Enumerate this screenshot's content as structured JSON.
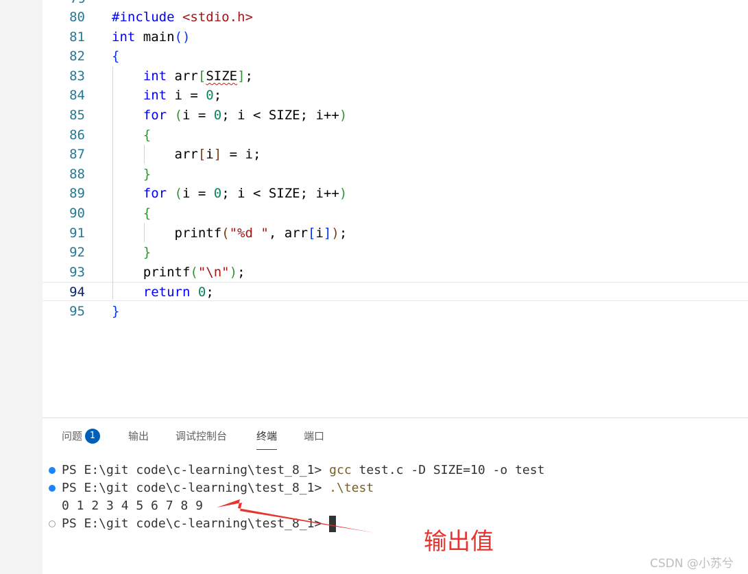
{
  "editor": {
    "top_partial_line_number": "79",
    "lines": [
      {
        "num": "80",
        "segments": [
          {
            "t": "#include ",
            "c": "pp"
          },
          {
            "t": "<stdio.h>",
            "c": "inc"
          }
        ]
      },
      {
        "num": "81",
        "segments": [
          {
            "t": "int",
            "c": "kw"
          },
          {
            "t": " main",
            "c": ""
          },
          {
            "t": "()",
            "c": "br1"
          }
        ]
      },
      {
        "num": "82",
        "segments": [
          {
            "t": "{",
            "c": "br1"
          }
        ]
      },
      {
        "num": "83",
        "segments": [
          {
            "t": "    ",
            "c": ""
          },
          {
            "t": "int",
            "c": "kw"
          },
          {
            "t": " arr",
            "c": ""
          },
          {
            "t": "[",
            "c": "br2"
          },
          {
            "t": "SIZE",
            "c": "squiggle"
          },
          {
            "t": "]",
            "c": "br2"
          },
          {
            "t": ";",
            "c": ""
          }
        ]
      },
      {
        "num": "84",
        "segments": [
          {
            "t": "    ",
            "c": ""
          },
          {
            "t": "int",
            "c": "kw"
          },
          {
            "t": " i = ",
            "c": ""
          },
          {
            "t": "0",
            "c": "num"
          },
          {
            "t": ";",
            "c": ""
          }
        ]
      },
      {
        "num": "85",
        "segments": [
          {
            "t": "    ",
            "c": ""
          },
          {
            "t": "for",
            "c": "kw"
          },
          {
            "t": " ",
            "c": ""
          },
          {
            "t": "(",
            "c": "br2"
          },
          {
            "t": "i = ",
            "c": ""
          },
          {
            "t": "0",
            "c": "num"
          },
          {
            "t": "; i < SIZE; i++",
            "c": ""
          },
          {
            "t": ")",
            "c": "br2"
          }
        ]
      },
      {
        "num": "86",
        "segments": [
          {
            "t": "    ",
            "c": ""
          },
          {
            "t": "{",
            "c": "br2"
          }
        ]
      },
      {
        "num": "87",
        "segments": [
          {
            "t": "        arr",
            "c": ""
          },
          {
            "t": "[",
            "c": "br3"
          },
          {
            "t": "i",
            "c": ""
          },
          {
            "t": "]",
            "c": "br3"
          },
          {
            "t": " = i;",
            "c": ""
          }
        ]
      },
      {
        "num": "88",
        "segments": [
          {
            "t": "    ",
            "c": ""
          },
          {
            "t": "}",
            "c": "br2"
          }
        ]
      },
      {
        "num": "89",
        "segments": [
          {
            "t": "    ",
            "c": ""
          },
          {
            "t": "for",
            "c": "kw"
          },
          {
            "t": " ",
            "c": ""
          },
          {
            "t": "(",
            "c": "br2"
          },
          {
            "t": "i = ",
            "c": ""
          },
          {
            "t": "0",
            "c": "num"
          },
          {
            "t": "; i < SIZE; i++",
            "c": ""
          },
          {
            "t": ")",
            "c": "br2"
          }
        ]
      },
      {
        "num": "90",
        "segments": [
          {
            "t": "    ",
            "c": ""
          },
          {
            "t": "{",
            "c": "br2"
          }
        ]
      },
      {
        "num": "91",
        "segments": [
          {
            "t": "        printf",
            "c": ""
          },
          {
            "t": "(",
            "c": "br3"
          },
          {
            "t": "\"%d \"",
            "c": "str"
          },
          {
            "t": ", arr",
            "c": ""
          },
          {
            "t": "[",
            "c": "br1"
          },
          {
            "t": "i",
            "c": ""
          },
          {
            "t": "]",
            "c": "br1"
          },
          {
            "t": ")",
            "c": "br3"
          },
          {
            "t": ";",
            "c": ""
          }
        ]
      },
      {
        "num": "92",
        "segments": [
          {
            "t": "    ",
            "c": ""
          },
          {
            "t": "}",
            "c": "br2"
          }
        ]
      },
      {
        "num": "93",
        "segments": [
          {
            "t": "    printf",
            "c": ""
          },
          {
            "t": "(",
            "c": "br2"
          },
          {
            "t": "\"\\n\"",
            "c": "str"
          },
          {
            "t": ")",
            "c": "br2"
          },
          {
            "t": ";",
            "c": ""
          }
        ]
      },
      {
        "num": "94",
        "segments": [
          {
            "t": "    ",
            "c": ""
          },
          {
            "t": "return",
            "c": "kw"
          },
          {
            "t": " ",
            "c": ""
          },
          {
            "t": "0",
            "c": "num"
          },
          {
            "t": ";",
            "c": ""
          }
        ]
      },
      {
        "num": "95",
        "segments": [
          {
            "t": "}",
            "c": "br1"
          }
        ]
      }
    ],
    "current_line": "94"
  },
  "panel": {
    "tabs": [
      {
        "label": "问题",
        "badge": "1"
      },
      {
        "label": "输出"
      },
      {
        "label": "调试控制台"
      },
      {
        "label": "终端",
        "active": true
      },
      {
        "label": "端口"
      }
    ],
    "terminal": [
      {
        "dot": "blue",
        "prompt": "PS E:\\git code\\c-learning\\test_8_1> ",
        "cmd": "gcc",
        "rest": " test.c -D SIZE=10 -o test"
      },
      {
        "dot": "blue",
        "prompt": "PS E:\\git code\\c-learning\\test_8_1> ",
        "cmd": ".\\test",
        "rest": ""
      },
      {
        "dot": "",
        "prompt": "0 1 2 3 4 5 6 7 8 9",
        "cmd": "",
        "rest": ""
      },
      {
        "dot": "hollow",
        "prompt": "PS E:\\git code\\c-learning\\test_8_1> ",
        "cmd": "",
        "rest": "",
        "cursor": true
      }
    ]
  },
  "annotation": {
    "text": "输出值",
    "color": "#e8342f"
  },
  "watermark": "CSDN @小苏兮"
}
